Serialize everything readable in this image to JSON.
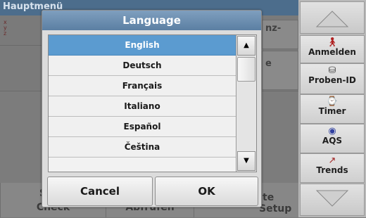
{
  "background": {
    "title": "Hauptmenü",
    "tile_top_right": "nz-",
    "tile_mid_right": "e",
    "bottom_left_fragment": "S",
    "bottom_left_text": "Check",
    "bottom_mid_text": "Abfrufen",
    "bottom_right_fragment": "te",
    "bottom_right_text": "Setup"
  },
  "sidebar": {
    "buttons": [
      {
        "label": "Anmelden",
        "icon": "person-icon"
      },
      {
        "label": "Proben-ID",
        "icon": "sample-vial-icon"
      },
      {
        "label": "Timer",
        "icon": "timer-icon"
      },
      {
        "label": "AQS",
        "icon": "aqs-icon"
      },
      {
        "label": "Trends",
        "icon": "trends-chart-icon"
      }
    ]
  },
  "dialog": {
    "title": "Language",
    "languages": [
      "English",
      "Deutsch",
      "Français",
      "Italiano",
      "Español",
      "Čeština"
    ],
    "selected": "English",
    "cancel_label": "Cancel",
    "ok_label": "OK"
  },
  "colors": {
    "title_blue": "#5b7fa3",
    "selected_blue": "#5b9bd0"
  }
}
